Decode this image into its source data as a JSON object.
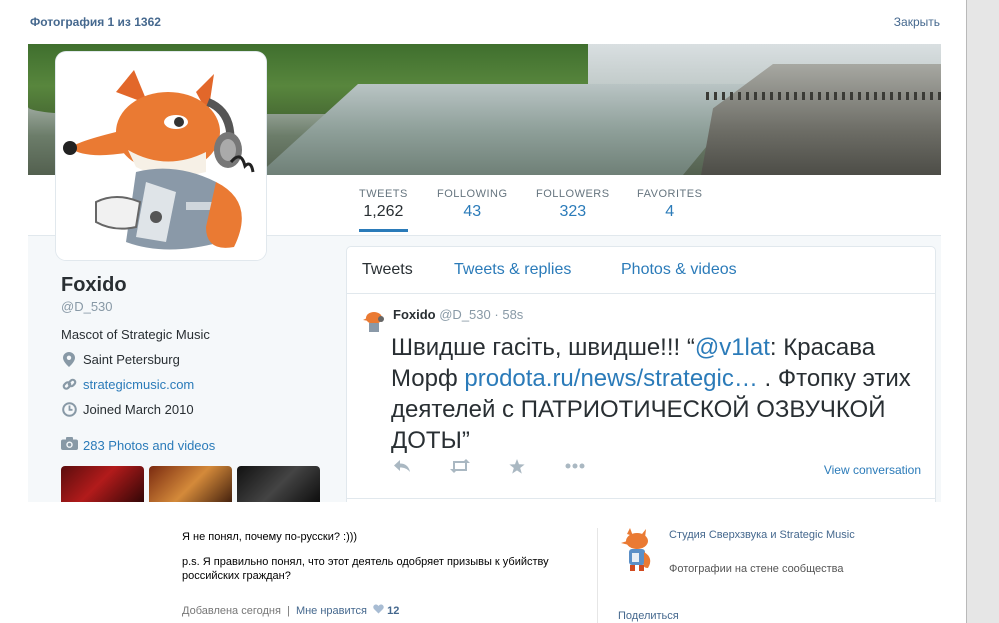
{
  "viewer": {
    "counter": "Фотография 1 из 1362",
    "close_label": "Закрыть"
  },
  "profile_card": {
    "stats": [
      {
        "label": "TWEETS",
        "value": "1,262"
      },
      {
        "label": "FOLLOWING",
        "value": "43"
      },
      {
        "label": "FOLLOWERS",
        "value": "323"
      },
      {
        "label": "FAVORITES",
        "value": "4"
      }
    ],
    "name": "Foxido",
    "handle": "@D_530",
    "bio": "Mascot of Strategic Music",
    "location": "Saint Petersburg",
    "website": "strategicmusic.com",
    "joined": "Joined March 2010",
    "photos_link": "283 Photos and videos"
  },
  "timeline": {
    "tabs": [
      "Tweets",
      "Tweets & replies",
      "Photos & videos"
    ],
    "tweet": {
      "name": "Foxido",
      "handle": "@D_530",
      "time": "58s",
      "text_part1": "Швидше гасіть, швидше!!! “",
      "mention": "@v1lat",
      "text_part2": ": Красава Морф ",
      "link": "prodota.ru/news/strategic…",
      "text_part3": " . Фтопку этих деятелей с ПАТРИОТИЧЕСКОЙ ОЗВУЧКОЙ ДОТЫ”",
      "view_conversation": "View conversation"
    }
  },
  "comment": {
    "line1": "Я не понял, почему по-русски? :)))",
    "line2": "p.s. Я правильно понял, что этот деятель одобряет призывы к убийству российских граждан?",
    "added": "Добавлена сегодня",
    "separator": "|",
    "like_label": "Мне нравится",
    "like_count": "12"
  },
  "sidebar": {
    "title": "Студия Сверхзвука и Strategic Music",
    "subtitle": "Фотографии на стене сообщества",
    "share": "Поделиться"
  },
  "colors": {
    "link": "#2b7bb9",
    "vk_link": "#45688e",
    "text": "#292f33",
    "muted": "#8899a6"
  }
}
